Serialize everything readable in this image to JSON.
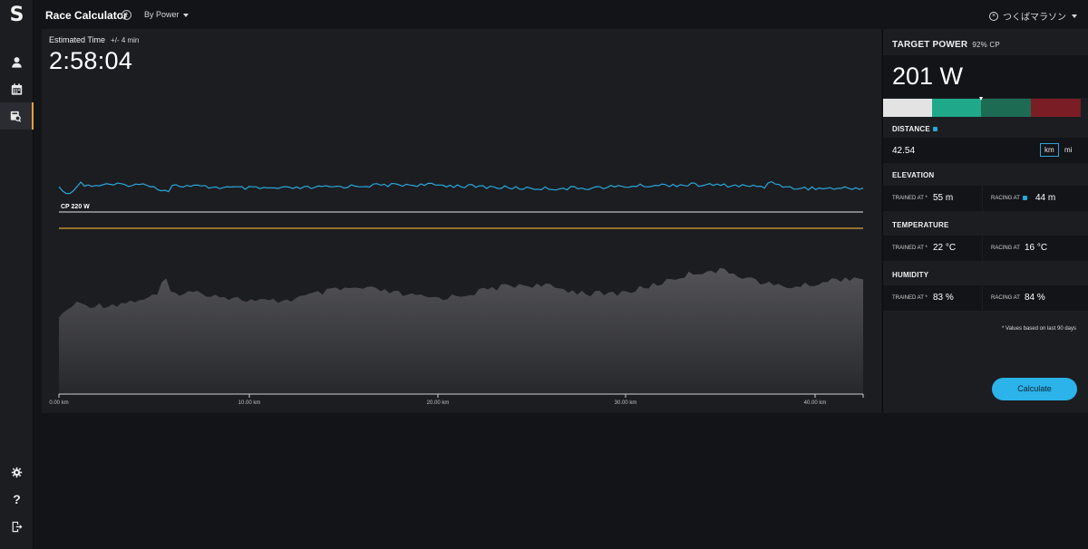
{
  "sidebar": {
    "logo": "S",
    "help_glyph": "?"
  },
  "header": {
    "title": "Race Calculator",
    "mode": "By Power",
    "race": "つくばマラソン"
  },
  "estimate": {
    "label": "Estimated Time",
    "range": "+/- 4 min",
    "time": "2:58:04"
  },
  "chart": {
    "cp_label": "CP 220 W",
    "distance_ticks": [
      "0.00 km",
      "10.00 km",
      "20.00 km",
      "30.00 km",
      "40.00 km"
    ],
    "colors": {
      "power_line": "#2aa6d9",
      "cp_line": "#e5e5e5",
      "target_line": "#e0a33a",
      "elevation_fill": "#545458"
    }
  },
  "target": {
    "head": "TARGET POWER",
    "pct": "92% CP",
    "value": "201 W",
    "zones": [
      "#e3e3e3",
      "#1fa98a",
      "#1e6b53",
      "#7a1d25"
    ]
  },
  "distance": {
    "head": "DISTANCE",
    "value": "42.54",
    "unit_km": "km",
    "unit_mi": "mi"
  },
  "elevation": {
    "head": "ELEVATION",
    "trained_label": "TRAINED AT *",
    "trained_value": "55 m",
    "racing_label": "RACING AT",
    "racing_value": "44 m"
  },
  "temperature": {
    "head": "TEMPERATURE",
    "trained_label": "TRAINED AT *",
    "trained_value": "22 °C",
    "racing_label": "RACING AT",
    "racing_value": "16 °C"
  },
  "humidity": {
    "head": "HUMIDITY",
    "trained_label": "TRAINED AT *",
    "trained_value": "83 %",
    "racing_label": "RACING AT",
    "racing_value": "84 %"
  },
  "footnote": "* Values based on last 90 days",
  "calculate_label": "Calculate"
}
